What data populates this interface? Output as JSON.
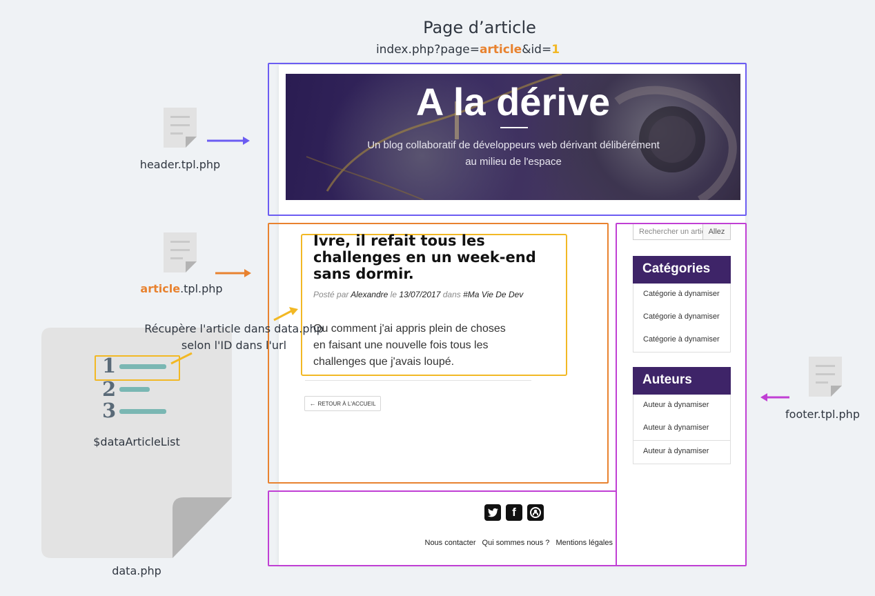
{
  "diagram": {
    "title": "Page d’article",
    "url": {
      "prefix": "index.php?page=",
      "page": "article",
      "middle": "&id=",
      "id": "1"
    }
  },
  "files": {
    "header": "header.tpl.php",
    "article_highlight": "article",
    "article_rest": ".tpl.php",
    "footer": "footer.tpl.php",
    "data": "data.php",
    "data_var": "$dataArticleList"
  },
  "data_list": {
    "numbers": [
      "1",
      "2",
      "3"
    ]
  },
  "annotation": {
    "line1": "Récupère l'article dans data.php",
    "line2": "selon l'ID dans l'url"
  },
  "colors": {
    "header": "#6b5cf2",
    "article": "#e8822f",
    "footer": "#c03fd4",
    "highlight": "#f2b824"
  },
  "site": {
    "title": "A la dérive",
    "subtitle_line1": "Un blog collaboratif de développeurs web dérivant délibérément",
    "subtitle_line2": "au milieu de l'espace"
  },
  "article": {
    "title": "Ivre, il refait tous les challenges en un week-end sans dormir.",
    "posted_by": "Posté par",
    "author": "Alexandre",
    "on": "le",
    "date": "13/07/2017",
    "in": "dans",
    "category": "#Ma Vie De Dev",
    "body": "Ou comment j'ai appris plein de choses en faisant une nouvelle fois tous les challenges que j'avais loupé.",
    "back_label": "RETOUR À L'ACCUEIL"
  },
  "sidebar": {
    "search_placeholder": "Rechercher un article",
    "search_button": "Allez",
    "categories_title": "Catégories",
    "categories": [
      "Catégorie à dynamiser",
      "Catégorie à dynamiser",
      "Catégorie à dynamiser"
    ],
    "authors_title": "Auteurs",
    "authors": [
      "Auteur à dynamiser",
      "Auteur à dynamiser",
      "Auteur à dynamiser"
    ]
  },
  "footer": {
    "icons": [
      "twitter-icon",
      "facebook-icon",
      "github-icon"
    ],
    "links": [
      "Nous contacter",
      "Qui sommes nous ?",
      "Mentions légales"
    ]
  }
}
